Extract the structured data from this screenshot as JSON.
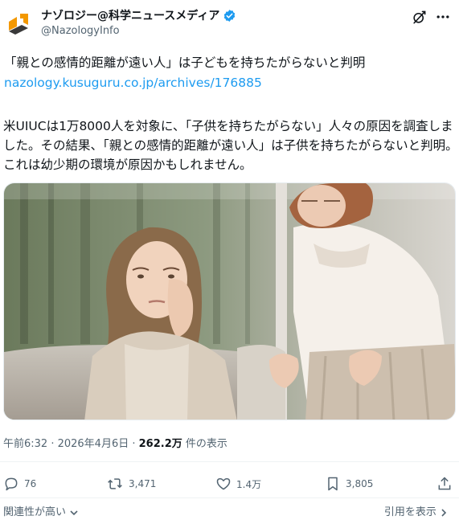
{
  "header": {
    "display_name": "ナゾロジー@科学ニュースメディア",
    "handle": "@NazologyInfo"
  },
  "post": {
    "title": "「親との感情的距離が遠い人」は子どもを持ちたがらないと判明",
    "link": "nazology.kusuguru.co.jp/archives/176885",
    "body": "米UIUCは1万8000人を対象に、「子供を持ちたがらない」人々の原因を調査しました。その結果、「親との感情的距離が遠い人」は子供を持ちたがらないと判明。これは幼少期の環境が原因かもしれません。"
  },
  "meta": {
    "time_date": "午前6:32 · 2026年4月6日 · ",
    "views_count": "262.2万",
    "views_label": " 件の表示"
  },
  "actions": {
    "replies": "76",
    "reposts": "3,471",
    "likes": "1.4万",
    "bookmarks": "3,805"
  },
  "footer": {
    "related": "関連性が高い",
    "quotes": "引用を表示"
  },
  "colors": {
    "link": "#1d9bf0",
    "verified": "#1d9bf0",
    "secondary_text": "#536471",
    "brand_orange": "#f39800"
  },
  "icons": {
    "avatar": "nazology-logo-icon",
    "verified": "verified-badge-icon",
    "grok": "grok-icon",
    "more": "more-dots-icon",
    "reply": "reply-icon",
    "repost": "repost-icon",
    "like": "heart-icon",
    "bookmark": "bookmark-icon",
    "share": "share-icon",
    "chevron": "chevron-down-icon"
  }
}
